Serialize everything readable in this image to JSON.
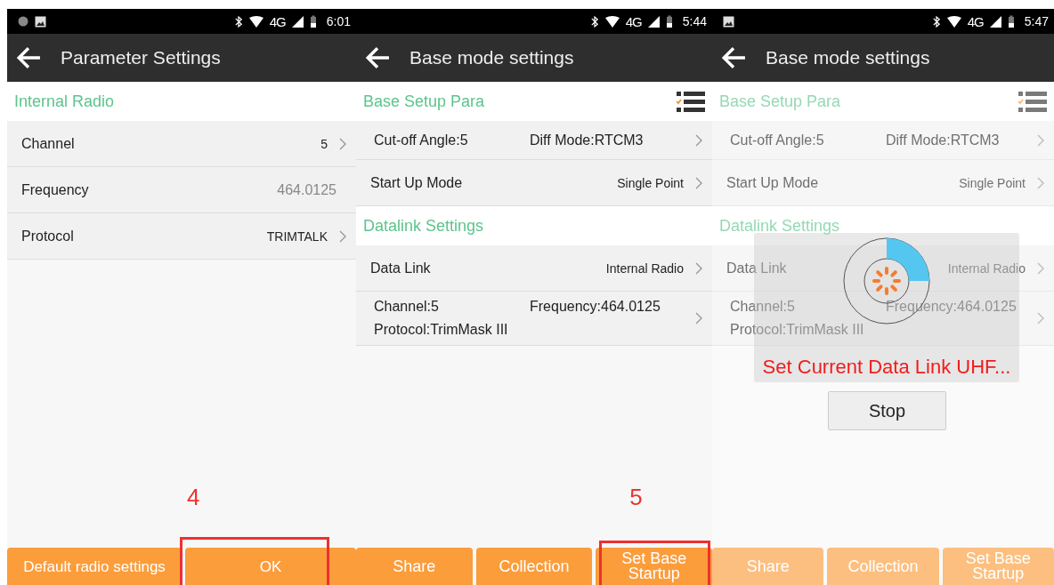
{
  "screens": [
    {
      "status_bar": {
        "icons": [
          {
            "kind": "dot"
          },
          {
            "kind": "image"
          }
        ],
        "network": "4G",
        "time": "6:01"
      },
      "title": "Parameter Settings",
      "sections": [
        {
          "heading": "Internal Radio",
          "list_icon": false,
          "rows": [
            {
              "kind": "single",
              "label": "Channel",
              "value": "5",
              "chevron": true
            },
            {
              "kind": "single",
              "label": "Frequency",
              "value": "464.0125",
              "chevron": false
            },
            {
              "kind": "single",
              "label": "Protocol",
              "value": "TRIMTALK",
              "chevron": true
            }
          ]
        }
      ],
      "buttons": [
        {
          "label": "Default radio settings",
          "highlighted": false
        },
        {
          "label": "OK",
          "highlighted": true
        }
      ],
      "step": "4",
      "dimmed": false
    },
    {
      "status_bar": {
        "network": "4G",
        "time": "5:44"
      },
      "title": "Base mode settings",
      "sections": [
        {
          "heading": "Base Setup Para",
          "list_icon": true,
          "rows": [
            {
              "kind": "grid",
              "cells": [
                "Cut-off Angle:5",
                "Diff Mode:RTCM3"
              ],
              "chevron": true
            },
            {
              "kind": "single",
              "label": "Start Up Mode",
              "value": "Single Point",
              "chevron": true
            }
          ]
        },
        {
          "heading": "Datalink Settings",
          "list_icon": false,
          "rows": [
            {
              "kind": "single",
              "label": "Data Link",
              "value": "Internal Radio",
              "chevron": true
            },
            {
              "kind": "grid",
              "cells": [
                "Channel:5",
                "Frequency:464.0125",
                "Protocol:TrimMask III"
              ],
              "chevron": true
            }
          ]
        }
      ],
      "buttons": [
        {
          "label": "Share",
          "highlighted": false
        },
        {
          "label": "Collection",
          "highlighted": false
        },
        {
          "label": "Set Base Startup",
          "highlighted": true
        }
      ],
      "step": "5",
      "dimmed": false
    },
    {
      "status_bar": {
        "icons": [
          {
            "kind": "image"
          }
        ],
        "network": "4G",
        "time": "5:47"
      },
      "title": "Base mode settings",
      "sections": [
        {
          "heading": "Base Setup Para",
          "list_icon": true,
          "rows": [
            {
              "kind": "grid",
              "cells": [
                "Cut-off Angle:5",
                "Diff Mode:RTCM3"
              ],
              "chevron": true
            },
            {
              "kind": "single",
              "label": "Start Up Mode",
              "value": "Single Point",
              "chevron": true
            }
          ]
        },
        {
          "heading": "Datalink Settings",
          "list_icon": false,
          "rows": [
            {
              "kind": "single",
              "label": "Data Link",
              "value": "Internal Radio",
              "chevron": true
            },
            {
              "kind": "grid",
              "cells": [
                "Channel:5",
                "Frequency:464.0125",
                "Protocol:TrimMask III"
              ],
              "chevron": true
            }
          ]
        }
      ],
      "buttons": [
        {
          "label": "Share",
          "highlighted": false
        },
        {
          "label": "Collection",
          "highlighted": false
        },
        {
          "label": "Set Base Startup",
          "highlighted": false
        }
      ],
      "dimmed": true,
      "dialog": {
        "message": "Set Current Data Link UHF...",
        "button": "Stop"
      }
    }
  ]
}
